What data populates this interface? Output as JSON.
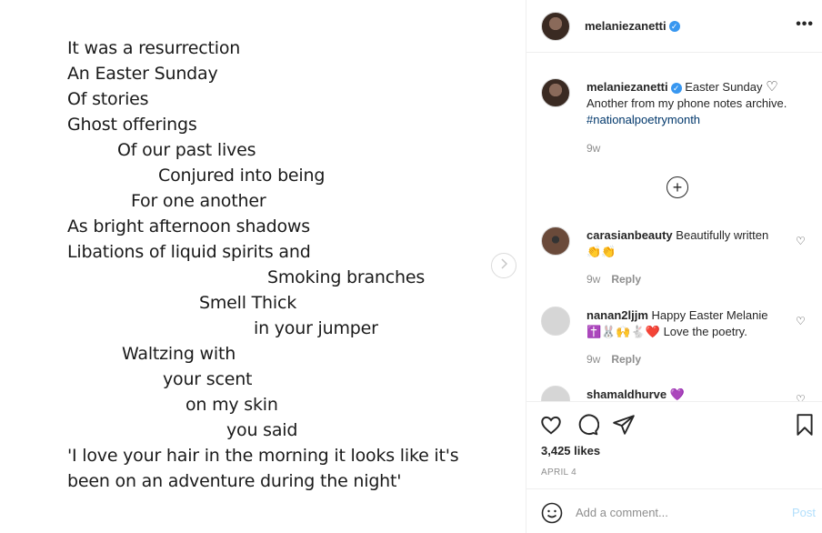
{
  "poem": {
    "lines": [
      "It was a resurrection",
      "An Easter Sunday",
      "Of stories",
      "Ghost offerings",
      "Of our past lives",
      "Conjured into being",
      "For one another",
      "As bright afternoon shadows",
      "Libations of liquid spirits and",
      "Smoking branches",
      "Smell Thick",
      "in your jumper",
      "Waltzing with",
      "your scent",
      "on my skin",
      "you said",
      "'I love your hair in the morning it looks like it's",
      "been on an adventure during the night'"
    ]
  },
  "header": {
    "username": "melaniezanetti",
    "more_label": "•••"
  },
  "caption": {
    "username": "melaniezanetti",
    "title": "Easter Sunday",
    "heart": "♡",
    "body": "Another from my phone notes archive.",
    "hashtag": "#nationalpoetrymonth",
    "time": "9w"
  },
  "comments": [
    {
      "username": "carasianbeauty",
      "text": "Beautifully written",
      "emoji": "👏👏",
      "time": "9w",
      "reply": "Reply"
    },
    {
      "username": "nanan2ljjm",
      "text": "Happy Easter Melanie",
      "emoji": "✝️🐰🙌🐇❤️",
      "text2": "Love the poetry.",
      "time": "9w",
      "reply": "Reply"
    },
    {
      "username": "shamaldhurve",
      "emoji": "💜"
    }
  ],
  "load_more": "+",
  "likes": "3,425 likes",
  "date": "APRIL 4",
  "add_comment": {
    "placeholder": "Add a comment...",
    "post_label": "Post"
  },
  "colors": {
    "link": "#00376b",
    "verified": "#3897f0",
    "post_disabled": "#b2dffc",
    "muted": "#8e8e8e"
  }
}
